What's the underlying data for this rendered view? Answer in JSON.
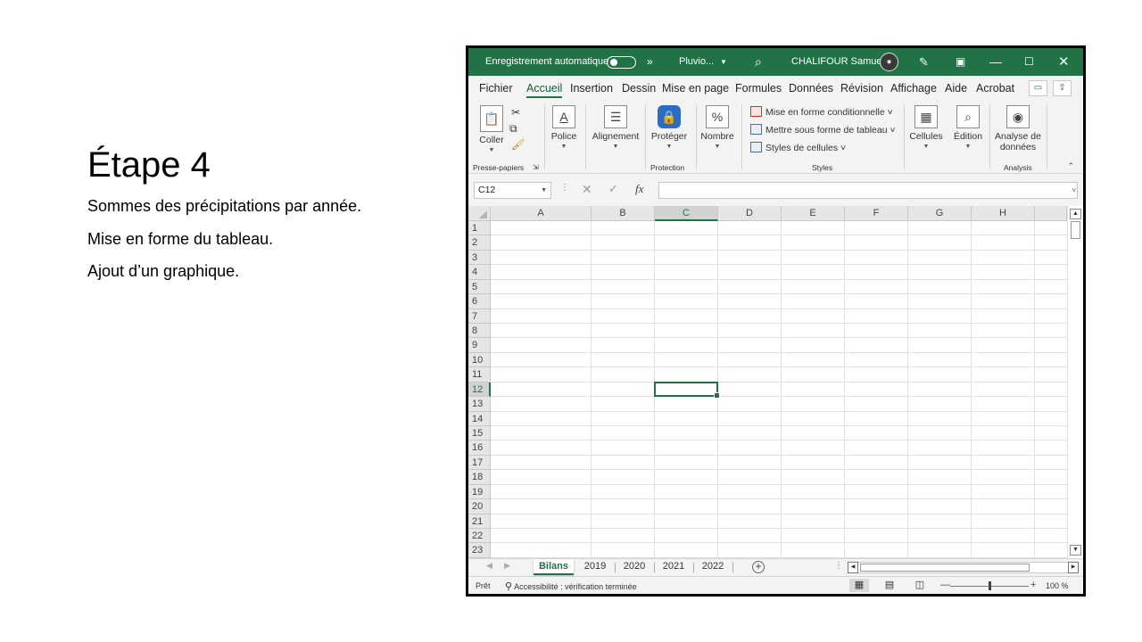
{
  "slide": {
    "title": "Étape 4",
    "bullets": [
      "Sommes des précipitations par année.",
      "Mise en forme du tableau.",
      "Ajout d’un graphique."
    ]
  },
  "titlebar": {
    "autosave_label": "Enregistrement automatique",
    "more_label": "»",
    "file_name": "Pluvio...",
    "user_name": "CHALIFOUR Samuel"
  },
  "tabs": [
    "Fichier",
    "Accueil",
    "Insertion",
    "Dessin",
    "Mise en page",
    "Formules",
    "Données",
    "Révision",
    "Affichage",
    "Aide",
    "Acrobat"
  ],
  "active_tab": "Accueil",
  "ribbon": {
    "coller": "Coller",
    "presse_papiers": "Presse-papiers",
    "police": "Police",
    "alignement": "Alignement",
    "proteger": "Protéger",
    "protection": "Protection",
    "nombre": "Nombre",
    "mise_en_forme_cond": "Mise en forme conditionnelle",
    "mettre_sous_forme": "Mettre sous forme de tableau",
    "styles_cellules": "Styles de cellules",
    "styles": "Styles",
    "cellules": "Cellules",
    "edition": "Édition",
    "analyse_1": "Analyse de",
    "analyse_2": "données",
    "analysis": "Analysis"
  },
  "formula_bar": {
    "name_box": "C12",
    "formula": ""
  },
  "grid": {
    "columns": [
      "A",
      "B",
      "C",
      "D",
      "E",
      "F",
      "G",
      "H"
    ],
    "rows": [
      "1",
      "2",
      "3",
      "4",
      "5",
      "6",
      "7",
      "8",
      "9",
      "10",
      "11",
      "12",
      "13",
      "14",
      "15",
      "16",
      "17",
      "18",
      "19",
      "20",
      "21",
      "22",
      "23"
    ],
    "selected_column": "C",
    "selected_row": "12"
  },
  "sheets": [
    "Bilans",
    "2019",
    "2020",
    "2021",
    "2022"
  ],
  "active_sheet": "Bilans",
  "status": {
    "ready": "Prêt",
    "accessibility": "Accessibilité : vérification terminée",
    "zoom": "100 %"
  },
  "colors": {
    "excel_green": "#217346",
    "selection_green": "#217346"
  }
}
